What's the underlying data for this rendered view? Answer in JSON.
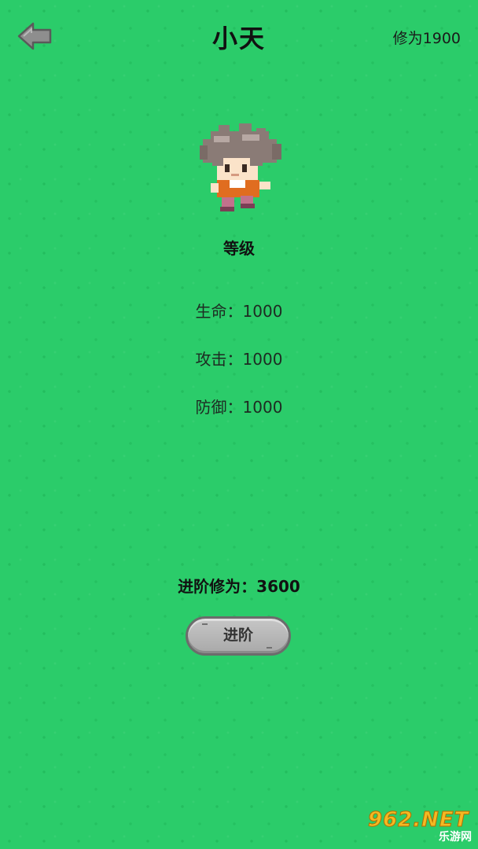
{
  "header": {
    "title": "小天",
    "cultivation": "修为1900"
  },
  "character": {
    "level_label": "等级",
    "stats": {
      "hp": "生命：1000",
      "attack": "攻击：1000",
      "defense": "防御：1000"
    }
  },
  "advance": {
    "requirement": "进阶修为：3600",
    "button_label": "进阶"
  },
  "watermark": {
    "brand": "962.NET",
    "site": "乐游网"
  },
  "colors": {
    "background": "#2bcc6a",
    "button": "#b8b8b8",
    "back_arrow": "#8a8a8a"
  },
  "icons": {
    "back": "back-arrow-icon",
    "avatar": "pixel-hero-sprite"
  }
}
